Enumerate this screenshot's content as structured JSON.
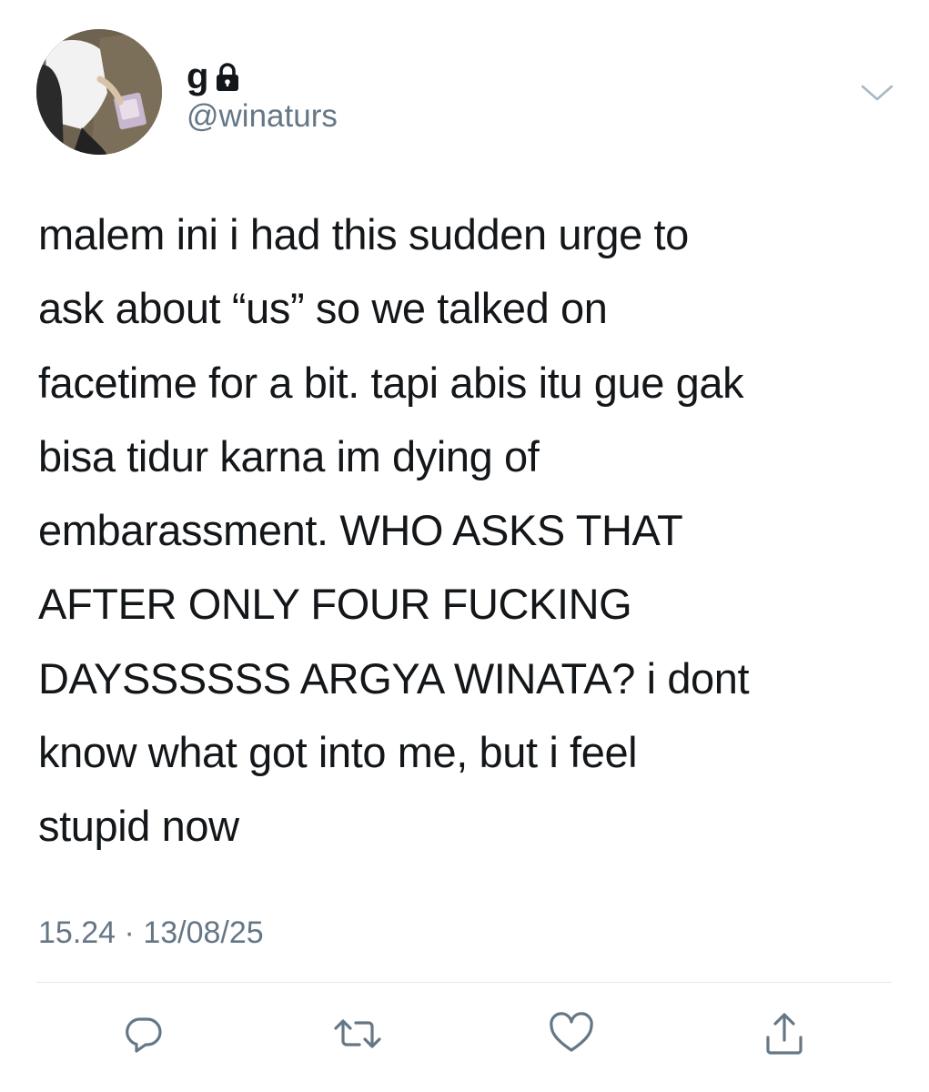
{
  "tweet": {
    "author": {
      "display_name": "g",
      "handle": "@winaturs",
      "protected_icon": "lock-icon",
      "avatar": "avatar-photo"
    },
    "menu_icon": "chevron-down-icon",
    "text": "malem ini i had this sudden urge to\nask about “us” so we talked on\nfacetime for a bit. tapi abis itu gue gak\nbisa tidur karna im dying of\nembarassment. WHO ASKS THAT\nAFTER ONLY FOUR FUCKING\nDAYSSSSSS ARGYA WINATA? i dont\nknow what got into me, but i feel\nstupid now",
    "time": "15.24",
    "separator": " · ",
    "date": "13/08/25",
    "actions": [
      {
        "name": "reply",
        "icon": "reply-icon"
      },
      {
        "name": "retweet",
        "icon": "retweet-icon"
      },
      {
        "name": "like",
        "icon": "heart-icon"
      },
      {
        "name": "share",
        "icon": "share-icon"
      }
    ]
  },
  "colors": {
    "text_primary": "#14171a",
    "text_secondary": "#657786",
    "icon": "#657786",
    "divider": "#e1e8ed",
    "background": "#ffffff"
  }
}
